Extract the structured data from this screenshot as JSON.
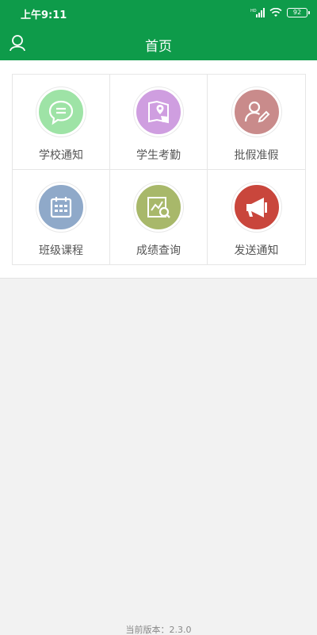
{
  "status_bar": {
    "time": "上午9:11",
    "network": "HD",
    "battery": "92"
  },
  "header": {
    "title": "首页",
    "profile_icon": "user-icon"
  },
  "theme": {
    "primary": "#0e9b4a",
    "background": "#f2f2f2"
  },
  "menu": [
    {
      "label": "学校通知",
      "icon": "chat-bubble-icon",
      "color": "#9ee3a6"
    },
    {
      "label": "学生考勤",
      "icon": "map-pin-icon",
      "color": "#cf9ee0"
    },
    {
      "label": "批假准假",
      "icon": "user-edit-icon",
      "color": "#c98b8b"
    },
    {
      "label": "班级课程",
      "icon": "calendar-icon",
      "color": "#8fa9c9"
    },
    {
      "label": "成绩查询",
      "icon": "chart-search-icon",
      "color": "#a8b86a"
    },
    {
      "label": "发送通知",
      "icon": "megaphone-icon",
      "color": "#c9463c"
    }
  ],
  "footer": {
    "version": "当前版本：2.3.0"
  }
}
